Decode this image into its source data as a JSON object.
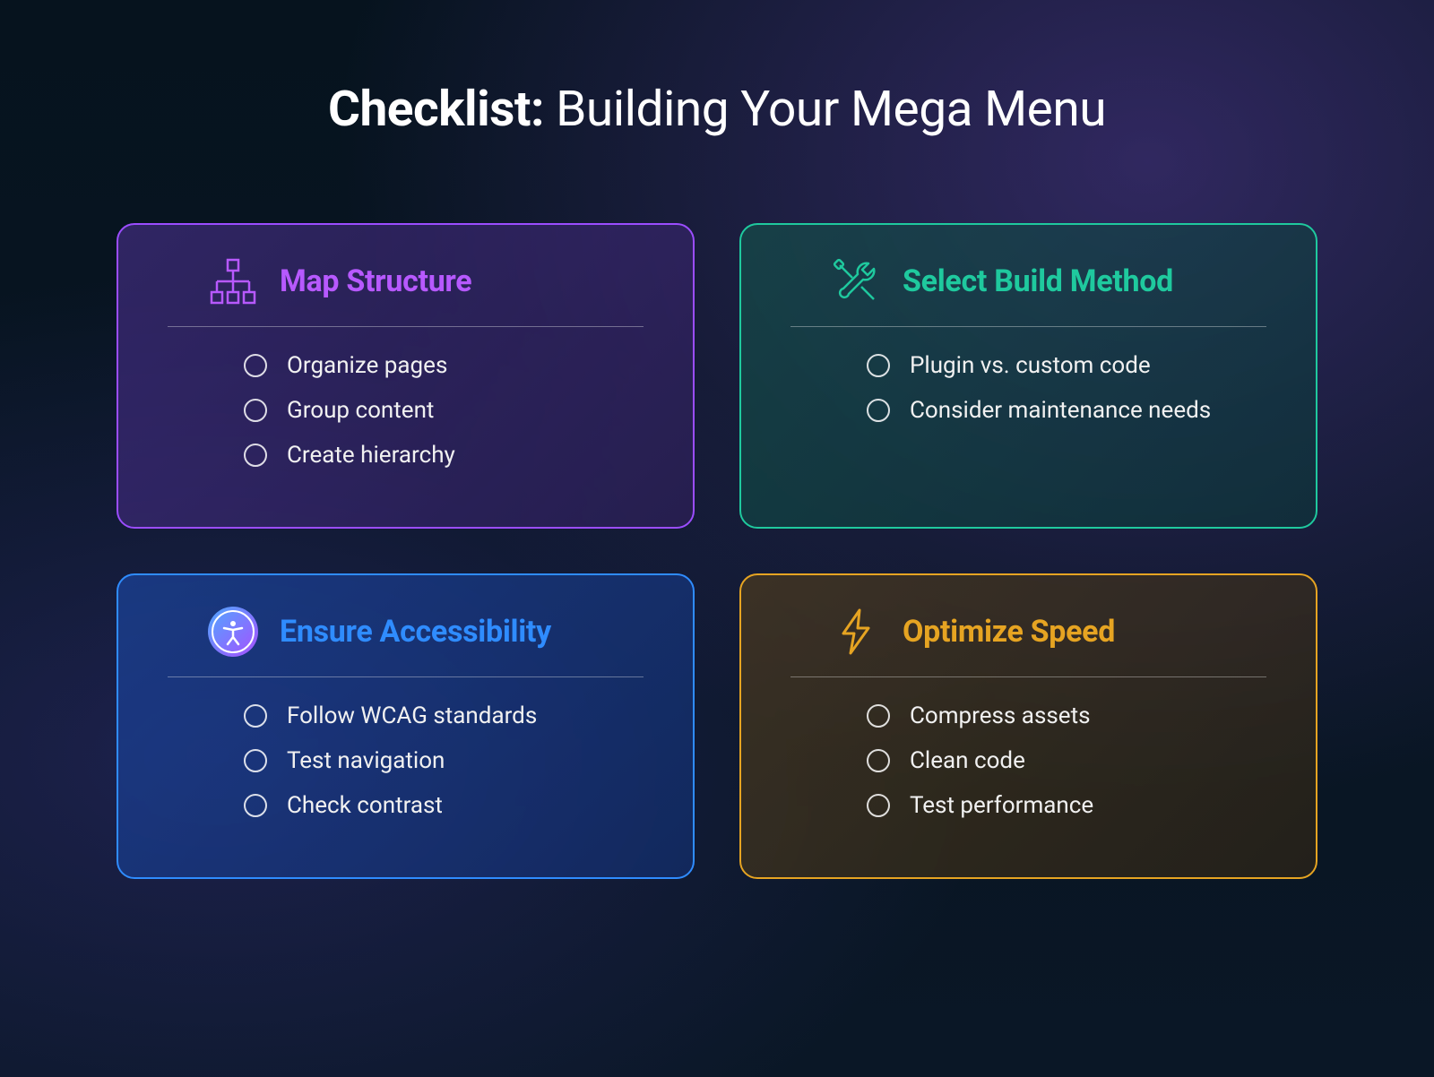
{
  "title": {
    "prefix": "Checklist:",
    "suffix": " Building Your Mega Menu"
  },
  "cards": [
    {
      "title": "Map Structure",
      "items": [
        "Organize pages",
        "Group content",
        "Create hierarchy"
      ]
    },
    {
      "title": "Select Build Method",
      "items": [
        "Plugin vs. custom code",
        "Consider maintenance needs"
      ]
    },
    {
      "title": "Ensure Accessibility",
      "items": [
        "Follow WCAG standards",
        "Test navigation",
        "Check contrast"
      ]
    },
    {
      "title": "Optimize Speed",
      "items": [
        "Compress assets",
        "Clean code",
        "Test performance"
      ]
    }
  ]
}
